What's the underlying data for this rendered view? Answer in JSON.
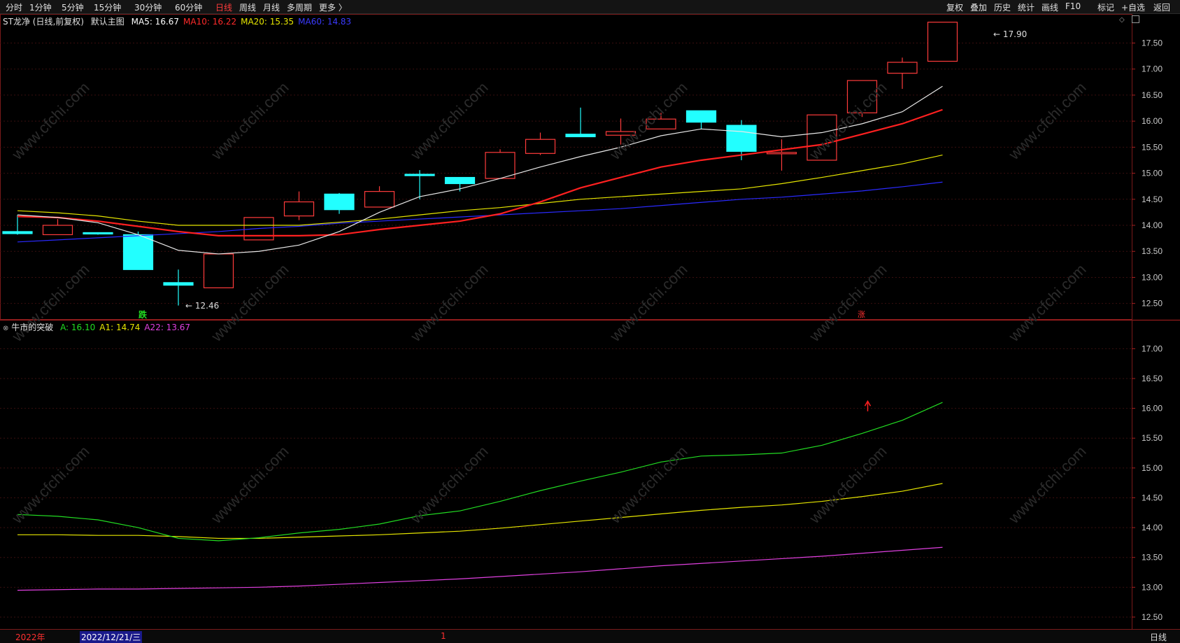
{
  "toolbar": {
    "periods": [
      {
        "label": "分时",
        "active": false
      },
      {
        "label": "1分钟",
        "active": false
      },
      {
        "label": "5分钟",
        "active": false
      },
      {
        "label": "15分钟",
        "active": false
      },
      {
        "label": "30分钟",
        "active": false
      },
      {
        "label": "60分钟",
        "active": false
      },
      {
        "label": "日线",
        "active": true
      },
      {
        "label": "周线",
        "active": false
      },
      {
        "label": "月线",
        "active": false
      },
      {
        "label": "多周期",
        "active": false
      },
      {
        "label": "更多 〉",
        "active": false
      }
    ],
    "right": [
      "复权",
      "叠加",
      "历史",
      "统计",
      "画线",
      "F10",
      "标记",
      "+自选",
      "返回"
    ]
  },
  "main_header": {
    "stock": "ST龙净 (日线,前复权)",
    "template": "默认主图",
    "ma": [
      {
        "label": "MA5: 16.67",
        "color": "#ffffff"
      },
      {
        "label": "MA10: 16.22",
        "color": "#ff2a2a"
      },
      {
        "label": "MA20: 15.35",
        "color": "#e6e600"
      },
      {
        "label": "MA60: 14.83",
        "color": "#3a3aff"
      }
    ]
  },
  "sub_header": {
    "name": "牛市的突破",
    "items": [
      {
        "label": "A: 16.10",
        "color": "#22dd22"
      },
      {
        "label": "A1: 14.74",
        "color": "#e6e600"
      },
      {
        "label": "A22: 13.67",
        "color": "#e040e0"
      }
    ]
  },
  "main_axis": [
    "17.50",
    "17.00",
    "16.50",
    "16.00",
    "15.50",
    "15.00",
    "14.50",
    "14.00",
    "13.50",
    "13.00",
    "12.50"
  ],
  "sub_axis": [
    "17.00",
    "16.50",
    "16.00",
    "15.50",
    "15.00",
    "14.50",
    "14.00",
    "13.50",
    "13.00",
    "12.50"
  ],
  "annotations": {
    "high": "17.90",
    "low": "12.46",
    "down_mark": "跌",
    "up_mark": "涨"
  },
  "date_bar": {
    "year": "2022年",
    "date": "2022/12/21/三",
    "cursor": "1",
    "period": "日线"
  },
  "watermark": "www.cfchi.com",
  "chart_data": {
    "type": "candlestick",
    "main_ylim": [
      12.2,
      17.95
    ],
    "sub_ylim": [
      12.3,
      17.45
    ],
    "candles": [
      {
        "o": 13.88,
        "c": 13.84,
        "h": 14.2,
        "l": 13.82
      },
      {
        "o": 13.82,
        "c": 14.0,
        "h": 14.12,
        "l": 13.82
      },
      {
        "o": 13.86,
        "c": 13.84,
        "h": 13.86,
        "l": 13.82
      },
      {
        "o": 13.82,
        "c": 13.15,
        "h": 13.88,
        "l": 13.15
      },
      {
        "o": 12.9,
        "c": 12.85,
        "h": 13.15,
        "l": 12.46
      },
      {
        "o": 12.8,
        "c": 13.45,
        "h": 13.45,
        "l": 12.8
      },
      {
        "o": 13.72,
        "c": 14.15,
        "h": 14.15,
        "l": 13.72
      },
      {
        "o": 14.18,
        "c": 14.45,
        "h": 14.65,
        "l": 14.1
      },
      {
        "o": 14.6,
        "c": 14.3,
        "h": 14.62,
        "l": 14.22
      },
      {
        "o": 14.35,
        "c": 14.65,
        "h": 14.75,
        "l": 14.35
      },
      {
        "o": 14.98,
        "c": 14.96,
        "h": 15.06,
        "l": 14.5
      },
      {
        "o": 14.92,
        "c": 14.8,
        "h": 14.92,
        "l": 14.65
      },
      {
        "o": 14.9,
        "c": 15.4,
        "h": 15.46,
        "l": 14.9
      },
      {
        "o": 15.38,
        "c": 15.65,
        "h": 15.78,
        "l": 15.35
      },
      {
        "o": 15.75,
        "c": 15.7,
        "h": 16.26,
        "l": 15.7
      },
      {
        "o": 15.73,
        "c": 15.8,
        "h": 16.05,
        "l": 15.55
      },
      {
        "o": 15.85,
        "c": 16.04,
        "h": 16.16,
        "l": 15.85
      },
      {
        "o": 16.2,
        "c": 15.98,
        "h": 16.2,
        "l": 15.85
      },
      {
        "o": 15.92,
        "c": 15.42,
        "h": 16.02,
        "l": 15.25
      },
      {
        "o": 15.38,
        "c": 15.4,
        "h": 15.65,
        "l": 15.05
      },
      {
        "o": 15.25,
        "c": 16.12,
        "h": 16.12,
        "l": 15.25
      },
      {
        "o": 16.16,
        "c": 16.78,
        "h": 16.78,
        "l": 16.08
      },
      {
        "o": 16.92,
        "c": 17.13,
        "h": 17.22,
        "l": 16.62
      },
      {
        "o": 17.15,
        "c": 17.9,
        "h": 17.9,
        "l": 17.15
      }
    ],
    "ma5": [
      14.2,
      14.15,
      14.05,
      13.82,
      13.52,
      13.45,
      13.5,
      13.62,
      13.88,
      14.25,
      14.55,
      14.7,
      14.9,
      15.12,
      15.32,
      15.5,
      15.72,
      15.85,
      15.8,
      15.7,
      15.78,
      15.95,
      16.18,
      16.67
    ],
    "ma10": [
      14.17,
      14.15,
      14.08,
      13.98,
      13.88,
      13.8,
      13.8,
      13.8,
      13.82,
      13.92,
      14.0,
      14.08,
      14.22,
      14.45,
      14.72,
      14.92,
      15.12,
      15.25,
      15.35,
      15.45,
      15.55,
      15.75,
      15.95,
      16.22
    ],
    "ma20": [
      14.28,
      14.24,
      14.18,
      14.08,
      14.0,
      14.0,
      14.0,
      14.0,
      14.06,
      14.12,
      14.2,
      14.28,
      14.34,
      14.42,
      14.5,
      14.55,
      14.6,
      14.65,
      14.7,
      14.8,
      14.92,
      15.05,
      15.18,
      15.35
    ],
    "ma60": [
      13.68,
      13.72,
      13.76,
      13.8,
      13.84,
      13.88,
      13.94,
      13.98,
      14.04,
      14.08,
      14.12,
      14.16,
      14.2,
      14.24,
      14.28,
      14.32,
      14.38,
      14.44,
      14.5,
      14.54,
      14.6,
      14.66,
      14.74,
      14.83
    ],
    "ind_A": [
      14.22,
      14.19,
      14.13,
      14.0,
      13.82,
      13.78,
      13.83,
      13.91,
      13.97,
      14.06,
      14.2,
      14.28,
      14.44,
      14.62,
      14.78,
      14.93,
      15.1,
      15.2,
      15.22,
      15.25,
      15.38,
      15.58,
      15.8,
      16.1
    ],
    "ind_A1": [
      13.88,
      13.88,
      13.87,
      13.87,
      13.85,
      13.82,
      13.82,
      13.84,
      13.86,
      13.88,
      13.91,
      13.94,
      13.99,
      14.05,
      14.11,
      14.17,
      14.23,
      14.29,
      14.34,
      14.38,
      14.44,
      14.52,
      14.61,
      14.74
    ],
    "ind_A22": [
      12.95,
      12.96,
      12.97,
      12.97,
      12.98,
      12.99,
      13.0,
      13.02,
      13.05,
      13.08,
      13.11,
      13.14,
      13.18,
      13.22,
      13.26,
      13.31,
      13.36,
      13.4,
      13.44,
      13.48,
      13.52,
      13.57,
      13.62,
      13.67
    ]
  }
}
